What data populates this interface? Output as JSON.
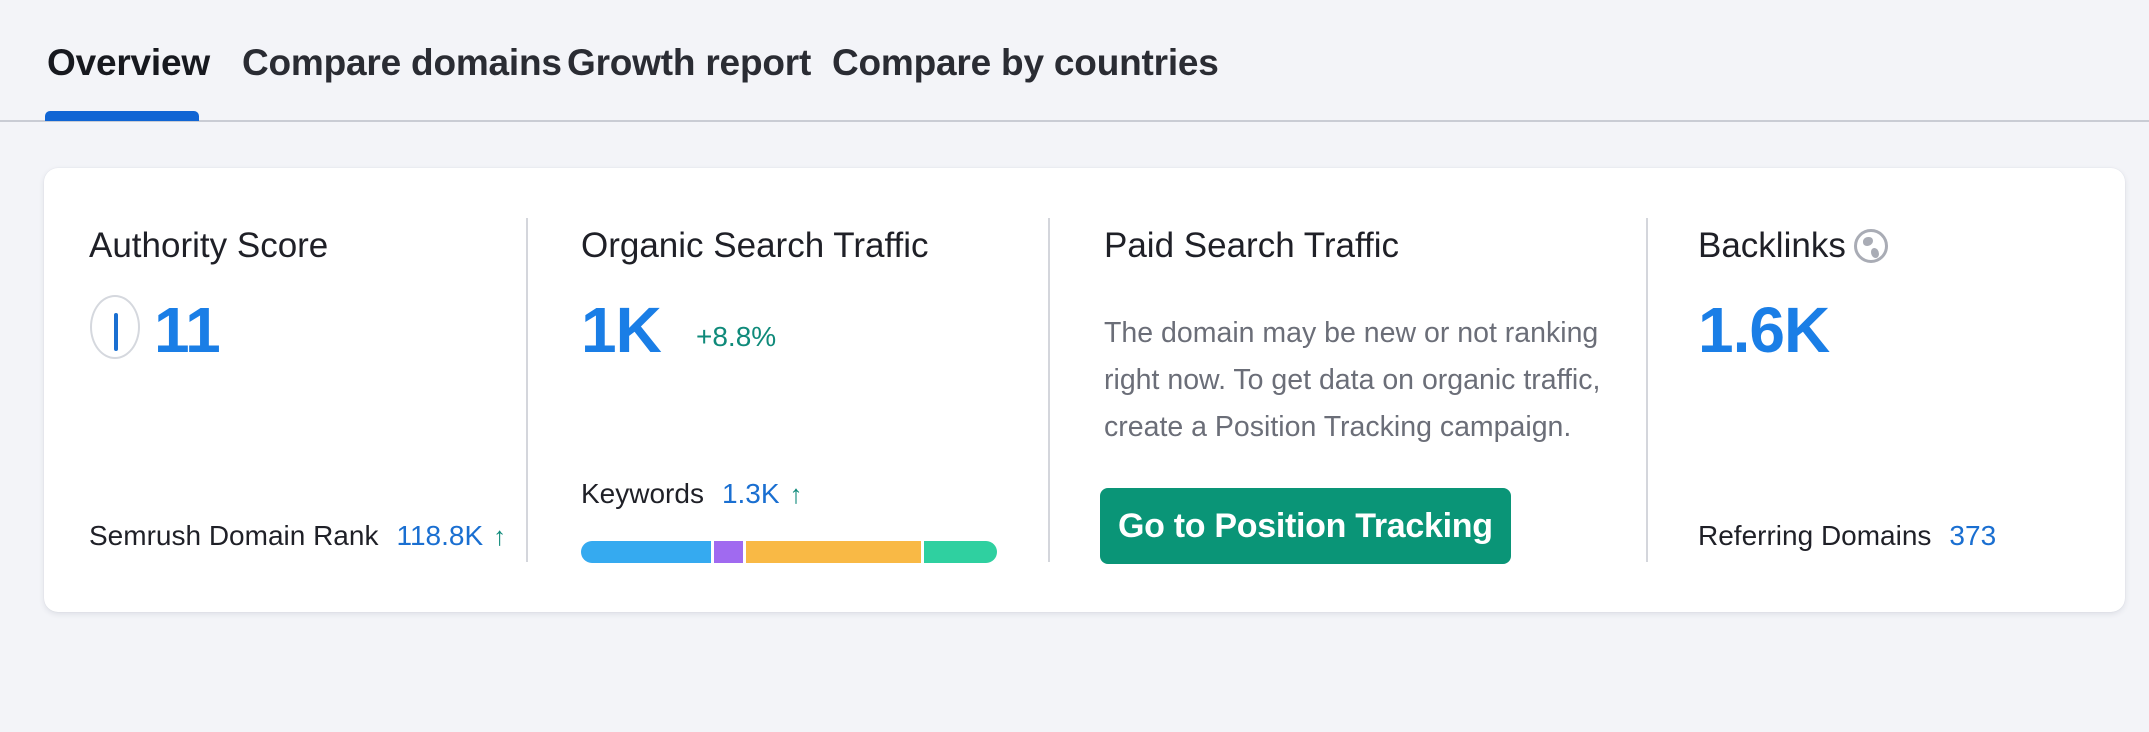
{
  "tabs": [
    {
      "label": "Overview",
      "active": true
    },
    {
      "label": "Compare domains",
      "active": false
    },
    {
      "label": "Growth report",
      "active": false
    },
    {
      "label": "Compare by countries",
      "active": false
    }
  ],
  "authority": {
    "title": "Authority Score",
    "value": "11",
    "rank_label": "Semrush Domain Rank",
    "rank_value": "118.8K",
    "rank_trend": "↑"
  },
  "organic": {
    "title": "Organic Search Traffic",
    "value": "1K",
    "delta": "+8.8%",
    "keywords_label": "Keywords",
    "keywords_value": "1.3K",
    "keywords_trend": "↑",
    "keyword_distribution": [
      {
        "share": 0.32,
        "color": "#35aaf0"
      },
      {
        "share": 0.07,
        "color": "#a06af0"
      },
      {
        "share": 0.43,
        "color": "#f9b945"
      },
      {
        "share": 0.18,
        "color": "#2fd0a0"
      }
    ]
  },
  "paid": {
    "title": "Paid Search Traffic",
    "description": "The domain may be new or not ranking right now. To get data on organic traffic, create a Position Tracking campaign.",
    "button_label": "Go to Position Tracking"
  },
  "backlinks": {
    "title": "Backlinks",
    "icon": "globe-icon",
    "value": "1.6K",
    "referring_label": "Referring Domains",
    "referring_value": "373"
  },
  "colors": {
    "accent_blue": "#1a7ee6",
    "tab_underline": "#1065d4",
    "positive_green": "#0f8a7a",
    "button_green": "#0a9577"
  }
}
